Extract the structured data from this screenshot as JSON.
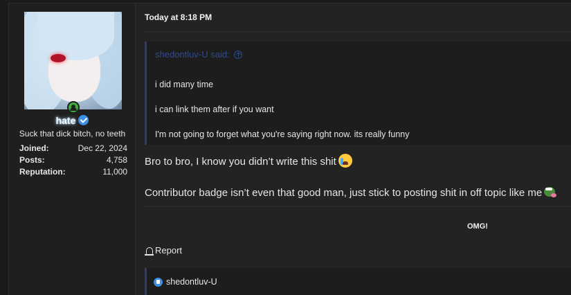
{
  "user": {
    "username": "hate",
    "title": "Suck that dick bitch, no teeth",
    "stats": [
      {
        "label": "Joined:",
        "value": "Dec 22, 2024"
      },
      {
        "label": "Posts:",
        "value": "4,758"
      },
      {
        "label": "Reputation:",
        "value": "11,000"
      }
    ]
  },
  "post": {
    "timestamp": "Today at 8:18 PM",
    "quote": {
      "author": "shedontluv-U said:",
      "lines": [
        "i did many time",
        "i can link them after if you want",
        "I'm not going to forget what you're saying right now. its really funny"
      ]
    },
    "body": [
      "Bro to bro, I know you didn’t write this shit",
      "Contributor badge isn’t even that good man, just stick to posting shit in off topic like me"
    ],
    "signature": "OMG!",
    "report_label": "Report",
    "liked_by": "shedontluv-U"
  },
  "icons": {
    "online": "user-online-icon",
    "verified": "verified-badge-icon",
    "quote_jump": "arrow-up-circle-icon",
    "cry_emoji": "loudly-crying-face-icon",
    "pepe_emoji": "pepe-frog-icon",
    "report": "bell-icon",
    "like": "like-icon"
  },
  "colors": {
    "background": "#1b1b1b",
    "post_bg": "#232323",
    "quote_accent": "#2f3d6e",
    "quote_author": "#2f4a8f",
    "verified": "#3d8fe0",
    "online": "#3fae3f"
  }
}
